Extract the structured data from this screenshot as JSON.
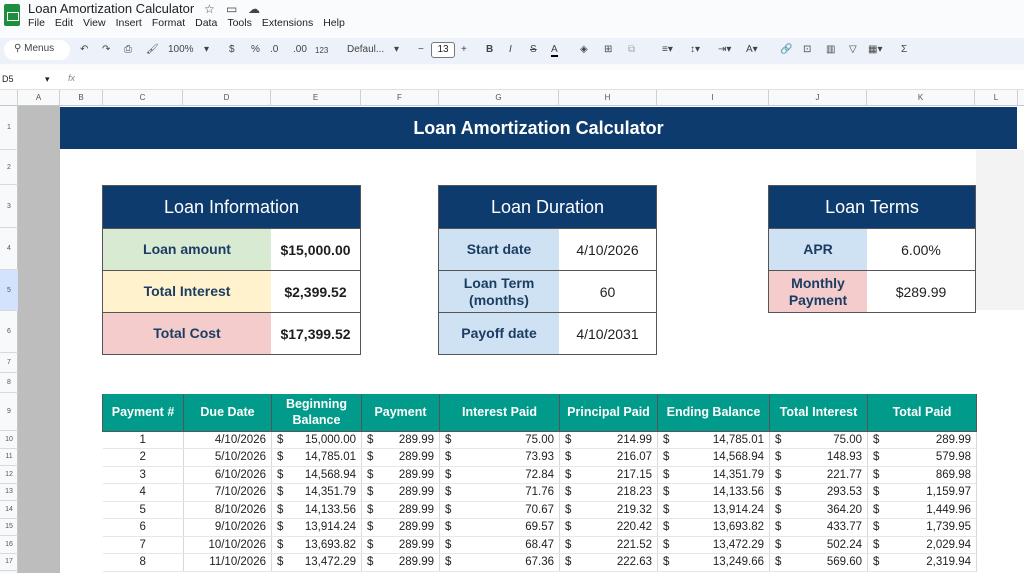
{
  "app": {
    "title": "Loan Amortization Calculator",
    "menu": [
      "File",
      "Edit",
      "View",
      "Insert",
      "Format",
      "Data",
      "Tools",
      "Extensions",
      "Help"
    ]
  },
  "toolbar": {
    "search": "Menus",
    "zoom": "100%",
    "currency": "$",
    "percent": "%",
    "dec_decrease": ".0",
    "dec_increase": ".00",
    "format_123": "123",
    "font": "Defaul...",
    "font_size": "13",
    "bold": "B",
    "italic": "I",
    "sum": "Σ"
  },
  "formula_bar": {
    "cell_ref": "D5",
    "fx": "fx",
    "value": ""
  },
  "columns": [
    "A",
    "B",
    "C",
    "D",
    "E",
    "F",
    "G",
    "H",
    "I",
    "J",
    "K",
    "L"
  ],
  "rows": [
    "1",
    "2",
    "3",
    "4",
    "5",
    "6",
    "7",
    "8",
    "9",
    "10",
    "11",
    "12",
    "13",
    "14",
    "15",
    "16",
    "17"
  ],
  "sheet": {
    "banner": "Loan Amortization Calculator",
    "loan_info": {
      "title": "Loan Information",
      "items": [
        {
          "label": "Loan amount",
          "value": "$15,000.00",
          "color": "#d9ead3"
        },
        {
          "label": "Total Interest",
          "value": "$2,399.52",
          "color": "#fff2cc"
        },
        {
          "label": "Total Cost",
          "value": "$17,399.52",
          "color": "#f4cccc"
        }
      ]
    },
    "loan_duration": {
      "title": "Loan Duration",
      "items": [
        {
          "label": "Start date",
          "value": "4/10/2026",
          "color": "#cfe2f3"
        },
        {
          "label": "Loan Term (months)",
          "value": "60",
          "color": "#cfe2f3"
        },
        {
          "label": "Payoff date",
          "value": "4/10/2031",
          "color": "#cfe2f3"
        }
      ]
    },
    "loan_terms": {
      "title": "Loan Terms",
      "items": [
        {
          "label": "APR",
          "value": "6.00%",
          "color": "#cfe2f3"
        },
        {
          "label": "Monthly Payment",
          "value": "$289.99",
          "color": "#f4cccc"
        }
      ]
    },
    "table": {
      "headers": [
        "Payment #",
        "Due Date",
        "Beginning Balance",
        "Payment",
        "Interest Paid",
        "Principal Paid",
        "Ending Balance",
        "Total Interest",
        "Total Paid"
      ],
      "currency_symbol": "$",
      "rows": [
        [
          "1",
          "4/10/2026",
          "15,000.00",
          "289.99",
          "75.00",
          "214.99",
          "14,785.01",
          "75.00",
          "289.99"
        ],
        [
          "2",
          "5/10/2026",
          "14,785.01",
          "289.99",
          "73.93",
          "216.07",
          "14,568.94",
          "148.93",
          "579.98"
        ],
        [
          "3",
          "6/10/2026",
          "14,568.94",
          "289.99",
          "72.84",
          "217.15",
          "14,351.79",
          "221.77",
          "869.98"
        ],
        [
          "4",
          "7/10/2026",
          "14,351.79",
          "289.99",
          "71.76",
          "218.23",
          "14,133.56",
          "293.53",
          "1,159.97"
        ],
        [
          "5",
          "8/10/2026",
          "14,133.56",
          "289.99",
          "70.67",
          "219.32",
          "13,914.24",
          "364.20",
          "1,449.96"
        ],
        [
          "6",
          "9/10/2026",
          "13,914.24",
          "289.99",
          "69.57",
          "220.42",
          "13,693.82",
          "433.77",
          "1,739.95"
        ],
        [
          "7",
          "10/10/2026",
          "13,693.82",
          "289.99",
          "68.47",
          "221.52",
          "13,472.29",
          "502.24",
          "2,029.94"
        ],
        [
          "8",
          "11/10/2026",
          "13,472.29",
          "289.99",
          "67.36",
          "222.63",
          "13,249.66",
          "569.60",
          "2,319.94"
        ]
      ]
    }
  }
}
